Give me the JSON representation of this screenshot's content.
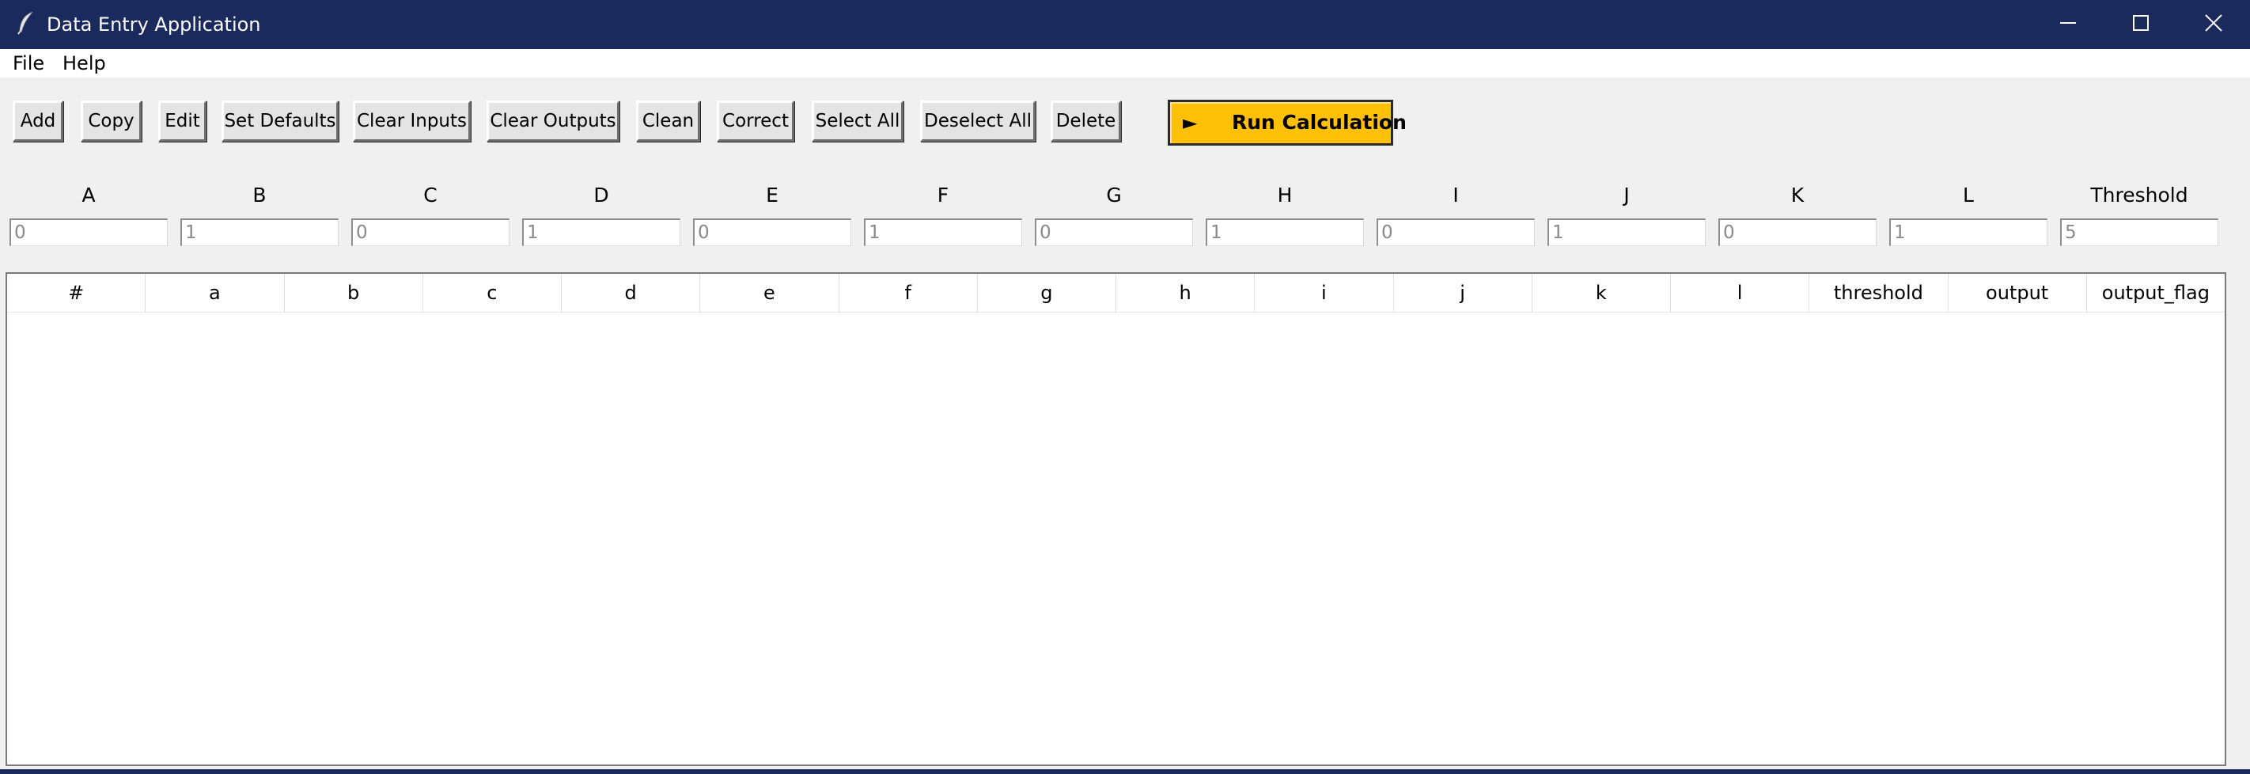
{
  "window": {
    "title": "Data Entry Application",
    "app_icon": "feather-icon",
    "controls": [
      "minimize-icon",
      "maximize-icon",
      "close-icon"
    ],
    "titlebar_color": "#1b2a5c"
  },
  "menu": {
    "file": "File",
    "help": "Help"
  },
  "toolbar": {
    "add": "Add",
    "copy": "Copy",
    "edit": "Edit",
    "set_defaults": "Set Defaults",
    "clear_inputs": "Clear Inputs",
    "clear_outputs": "Clear Outputs",
    "clean": "Clean",
    "correct": "Correct",
    "select_all": "Select All",
    "deselect_all": "Deselect All",
    "delete": "Delete",
    "run": {
      "icon": "play-icon",
      "glyph": "►",
      "label": "Run Calculation",
      "color": "#ffc107"
    }
  },
  "inputs": [
    {
      "label": "A",
      "value": "0"
    },
    {
      "label": "B",
      "value": "1"
    },
    {
      "label": "C",
      "value": "0"
    },
    {
      "label": "D",
      "value": "1"
    },
    {
      "label": "E",
      "value": "0"
    },
    {
      "label": "F",
      "value": "1"
    },
    {
      "label": "G",
      "value": "0"
    },
    {
      "label": "H",
      "value": "1"
    },
    {
      "label": "I",
      "value": "0"
    },
    {
      "label": "J",
      "value": "1"
    },
    {
      "label": "K",
      "value": "0"
    },
    {
      "label": "L",
      "value": "1"
    },
    {
      "label": "Threshold",
      "value": "5"
    }
  ],
  "table": {
    "columns": [
      "#",
      "a",
      "b",
      "c",
      "d",
      "e",
      "f",
      "g",
      "h",
      "i",
      "j",
      "k",
      "l",
      "threshold",
      "output",
      "output_flag"
    ],
    "rows": []
  }
}
